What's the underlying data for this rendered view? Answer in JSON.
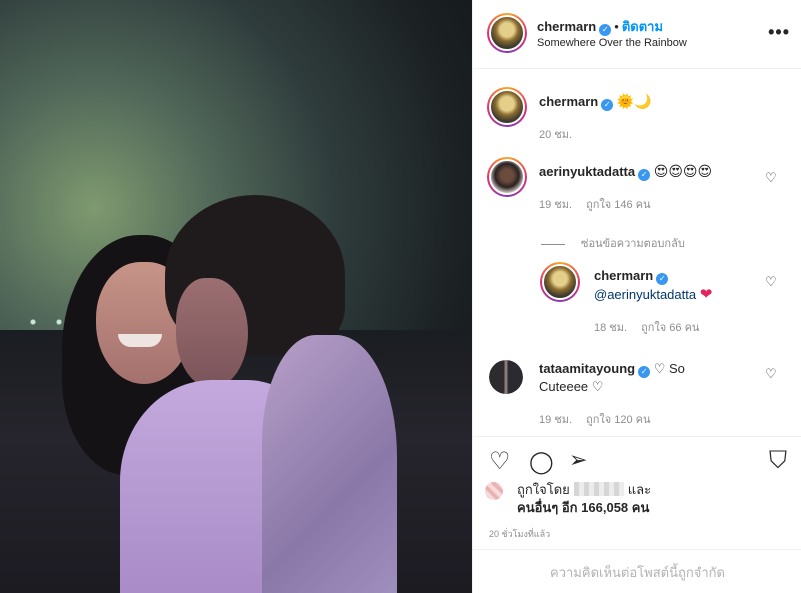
{
  "header": {
    "username": "chermarn",
    "follow_label": "ติดตาม",
    "subtitle": "Somewhere Over the Rainbow",
    "more_label": "•••"
  },
  "caption": {
    "username": "chermarn",
    "emojis": "🌞🌙",
    "time": "20 ชม."
  },
  "comments": [
    {
      "username": "aerinyuktadatta",
      "text": "😍😍😍😍",
      "time": "19 ชม.",
      "likes": "ถูกใจ 146 คน"
    },
    {
      "username": "chermarn",
      "mention": "@aerinyuktadatta",
      "emoji": "❤",
      "time": "18 ชม.",
      "likes": "ถูกใจ 66 คน"
    },
    {
      "username": "tataamitayoung",
      "text_1": "♡ So",
      "text_2": "Cuteeee ♡",
      "time": "19 ชม.",
      "likes": "ถูกใจ 120 คน"
    }
  ],
  "hide_replies_label": "ซ่อนข้อความตอบกลับ",
  "actions": {
    "like_icon": "♡",
    "comment_icon": "◯",
    "share_icon": "➢",
    "save_icon": "⛉"
  },
  "likers": {
    "prefix": "ถูกใจโดย",
    "and_label": "และ",
    "others": "คนอื่นๆ อีก 166,058 คน"
  },
  "post_time": "20 ชั่วโมงที่แล้ว",
  "comments_limited": "ความคิดเห็นต่อโพสต์นี้ถูกจำกัด",
  "colors": {
    "accent": "#0095f6",
    "verified": "#3897f0",
    "mention": "#00376b",
    "heart": "#e0245e"
  }
}
